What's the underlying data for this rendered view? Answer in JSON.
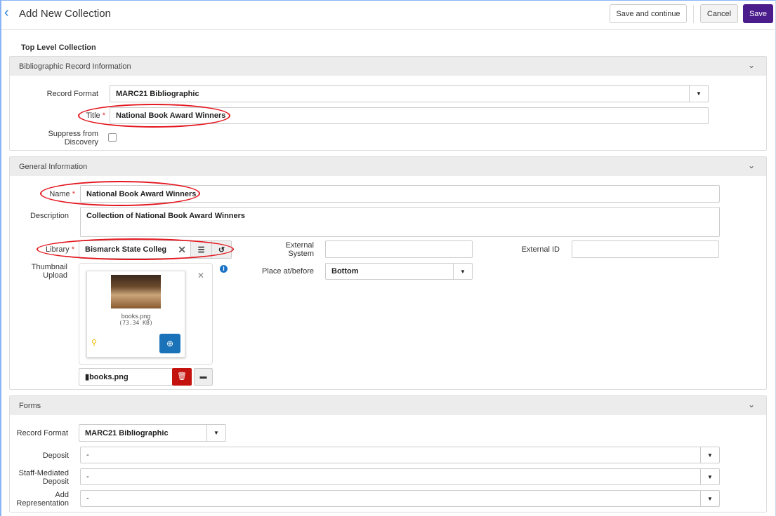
{
  "header": {
    "title": "Add New Collection",
    "save_continue": "Save and continue",
    "cancel": "Cancel",
    "save": "Save"
  },
  "top_level": "Top Level Collection",
  "biblio": {
    "title": "Bibliographic Record Information",
    "record_format_label": "Record Format",
    "record_format": "MARC21 Bibliographic",
    "title_label": "Title",
    "title_value": "National Book Award Winners",
    "suppress_label_1": "Suppress from",
    "suppress_label_2": "Discovery"
  },
  "general": {
    "title": "General Information",
    "name_label": "Name",
    "name_value": "National Book Award Winners",
    "description_label": "Description",
    "description_value": "Collection of National Book Award Winners",
    "library_label": "Library",
    "library_value": "Bismarck State Colleg",
    "external_system_label_1": "External",
    "external_system_label_2": "System",
    "external_id_label": "External ID",
    "thumbnail_label_1": "Thumbnail",
    "thumbnail_label_2": "Upload",
    "place_label": "Place at/before",
    "place_value": "Bottom",
    "file_name": "books.png",
    "file_size": "(73.34 KB)",
    "file_field": "books.png"
  },
  "forms": {
    "title": "Forms",
    "record_format_label": "Record Format",
    "record_format": "MARC21 Bibliographic",
    "deposit_label": "Deposit",
    "deposit_value": "-",
    "staff_label_1": "Staff-Mediated",
    "staff_label_2": "Deposit",
    "staff_value": "-",
    "addrep_label_1": "Add",
    "addrep_label_2": "Representation",
    "addrep_value": "-"
  },
  "colors": {
    "accent": "#4b1c8c",
    "annotation": "#e3161e",
    "info": "#1a73c8",
    "delete": "#c4120e"
  }
}
